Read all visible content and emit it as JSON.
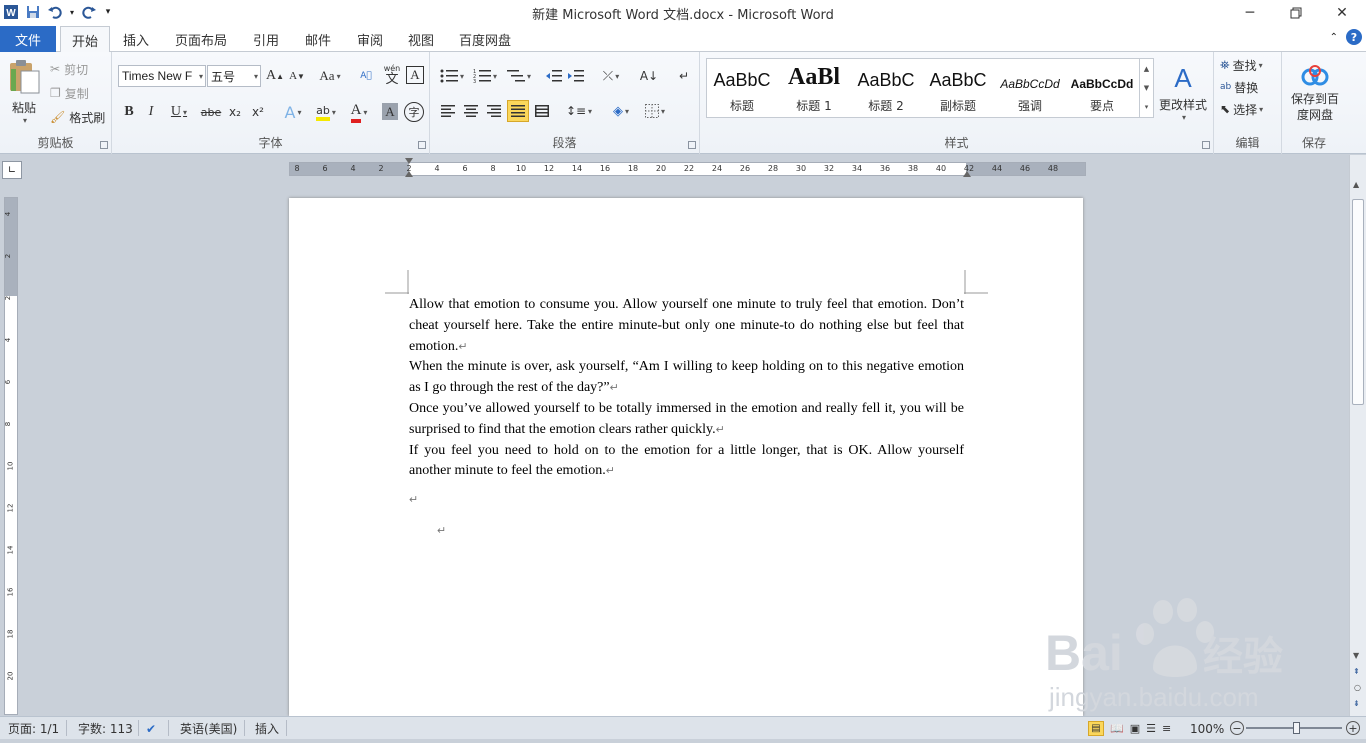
{
  "window": {
    "title": "新建 Microsoft Word 文档.docx  -  Microsoft Word",
    "controls": [
      "minimize",
      "restore",
      "close"
    ]
  },
  "ribbon_tabs": [
    {
      "label": "文件"
    },
    {
      "label": "开始",
      "active": true
    },
    {
      "label": "插入"
    },
    {
      "label": "页面布局"
    },
    {
      "label": "引用"
    },
    {
      "label": "邮件"
    },
    {
      "label": "审阅"
    },
    {
      "label": "视图"
    },
    {
      "label": "百度网盘"
    }
  ],
  "clipboard": {
    "paste": "粘贴",
    "cut": "剪切",
    "copy": "复制",
    "format_painter": "格式刷",
    "label": "剪贴板"
  },
  "font": {
    "name": "Times New F",
    "size": "五号",
    "label": "字体",
    "grow": "A",
    "shrink": "A",
    "change_case": "Aa",
    "bold": "B",
    "italic": "I",
    "underline": "U",
    "strike": "abe",
    "subscript": "x₂",
    "superscript": "x²",
    "char_border": "A",
    "text_effect": "A",
    "highlight": "ab",
    "font_color": "A",
    "char_shading": "A",
    "enclose": "字",
    "phonetic": "文",
    "wen": "wén"
  },
  "paragraph": {
    "label": "段落"
  },
  "styles": {
    "label": "样式",
    "items": [
      {
        "sample": "AaBbC",
        "name": "标题"
      },
      {
        "sample": "AaBl",
        "name": "标题 1"
      },
      {
        "sample": "AaBbC",
        "name": "标题 2"
      },
      {
        "sample": "AaBbC",
        "name": "副标题"
      },
      {
        "sample": "AaBbCcDd",
        "name": "强调"
      },
      {
        "sample": "AaBbCcDd",
        "name": "要点"
      }
    ],
    "change_styles": "更改样式"
  },
  "editing": {
    "find": "查找",
    "replace": "替换",
    "select": "选择",
    "label": "编辑"
  },
  "save": {
    "button": "保存到百度网盘",
    "button_line1": "保存到百",
    "button_line2": "度网盘",
    "label": "保存"
  },
  "ruler": {
    "ticks": [
      "8",
      "6",
      "4",
      "2",
      "2",
      "4",
      "6",
      "8",
      "10",
      "12",
      "14",
      "16",
      "18",
      "20",
      "22",
      "24",
      "26",
      "28",
      "30",
      "32",
      "34",
      "36",
      "38",
      "40",
      "42",
      "44",
      "46",
      "48"
    ]
  },
  "vruler": {
    "ticks": [
      "4",
      "2",
      "2",
      "4",
      "6",
      "8",
      "10",
      "12",
      "14",
      "16",
      "18",
      "20"
    ]
  },
  "document": {
    "paragraphs": [
      "Allow that emotion to consume you. Allow yourself one minute to truly feel that emotion. Don’t cheat yourself here. Take the entire minute-but only one minute-to do nothing else but feel that emotion.",
      "When the minute is over, ask yourself, “Am I willing to keep holding on to this negative emotion as I go through the rest of the day?”",
      "Once you’ve allowed yourself to be totally immersed in the emotion and really fell it, you will be surprised to find that the emotion clears rather quickly.",
      "If you feel you need to hold on to the emotion for a little longer, that is OK. Allow yourself another minute to feel the emotion."
    ],
    "paragraph_mark": "↵"
  },
  "status": {
    "page": "页面: 1/1",
    "words": "字数: 113",
    "language": "英语(美国)",
    "mode": "插入",
    "zoom": "100%",
    "zoom_minus": "−",
    "zoom_plus": "+"
  },
  "watermark": {
    "brand": "Bai",
    "brand_cn": "经验",
    "url": "jingyan.baidu.com"
  },
  "colors": {
    "file_tab": "#2b6bc6",
    "accent": "#2b6bc6"
  }
}
